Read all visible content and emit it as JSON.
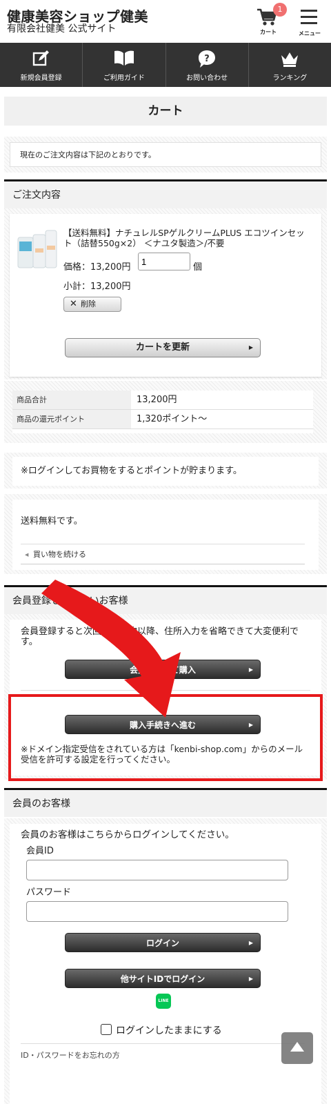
{
  "header": {
    "site_title": "健康美容ショップ健美",
    "site_subtitle": "有限会社健美 公式サイト",
    "cart_label": "カート",
    "cart_count": "1",
    "menu_label": "メニュー"
  },
  "nav": [
    {
      "label": "新規会員登録",
      "icon": "pencil-icon"
    },
    {
      "label": "ご利用ガイド",
      "icon": "book-icon"
    },
    {
      "label": "お問い合わせ",
      "icon": "question-bubble-icon"
    },
    {
      "label": "ランキング",
      "icon": "crown-icon"
    }
  ],
  "page_title": "カート",
  "intro_text": "現在のご注文内容は下記のとおりです。",
  "order": {
    "heading": "ご注文内容",
    "product_name": "【送料無料】ナチュレルSPゲルクリームPLUS エコツインセット（詰替550g×2） ＜ナユタ製造＞/不要",
    "price_label": "価格：13,200円",
    "quantity": "1",
    "quantity_unit": "個",
    "subtotal": "小計：13,200円",
    "delete_label": "削除",
    "update_label": "カートを更新"
  },
  "totals": [
    {
      "label": "商品合計",
      "value": "13,200円"
    },
    {
      "label": "商品の還元ポイント",
      "value": "1,320ポイント〜"
    }
  ],
  "point_note": "※ログインしてお買物をするとポイントが貯まります。",
  "shipping_text": "送料無料です。",
  "continue_label": "買い物を続ける",
  "guest": {
    "heading": "会員登録していないお客様",
    "description": "会員登録すると次回お買い物以降、住所入力を省略できて大変便利です。",
    "register_button": "会員登録して購入",
    "proceed_button": "購入手続きへ進む",
    "note": "※ドメイン指定受信をされている方は「kenbi-shop.com」からのメール受信を許可する設定を行ってください。"
  },
  "member": {
    "heading": "会員のお客様",
    "description": "会員のお客様はこちらからログインしてください。",
    "id_label": "会員ID",
    "id_value": "",
    "password_label": "パスワード",
    "password_value": "",
    "login_button": "ログイン",
    "other_login_button": "他サイトIDでログイン",
    "line_icon_text": "LINE",
    "keep_login_label": "ログインしたままにする",
    "forgot_link": "ID・パスワードをお忘れの方"
  },
  "colors": {
    "accent_red": "#e6191b",
    "nav_bg": "#333333",
    "badge": "#f07070",
    "line_green": "#06c755"
  }
}
